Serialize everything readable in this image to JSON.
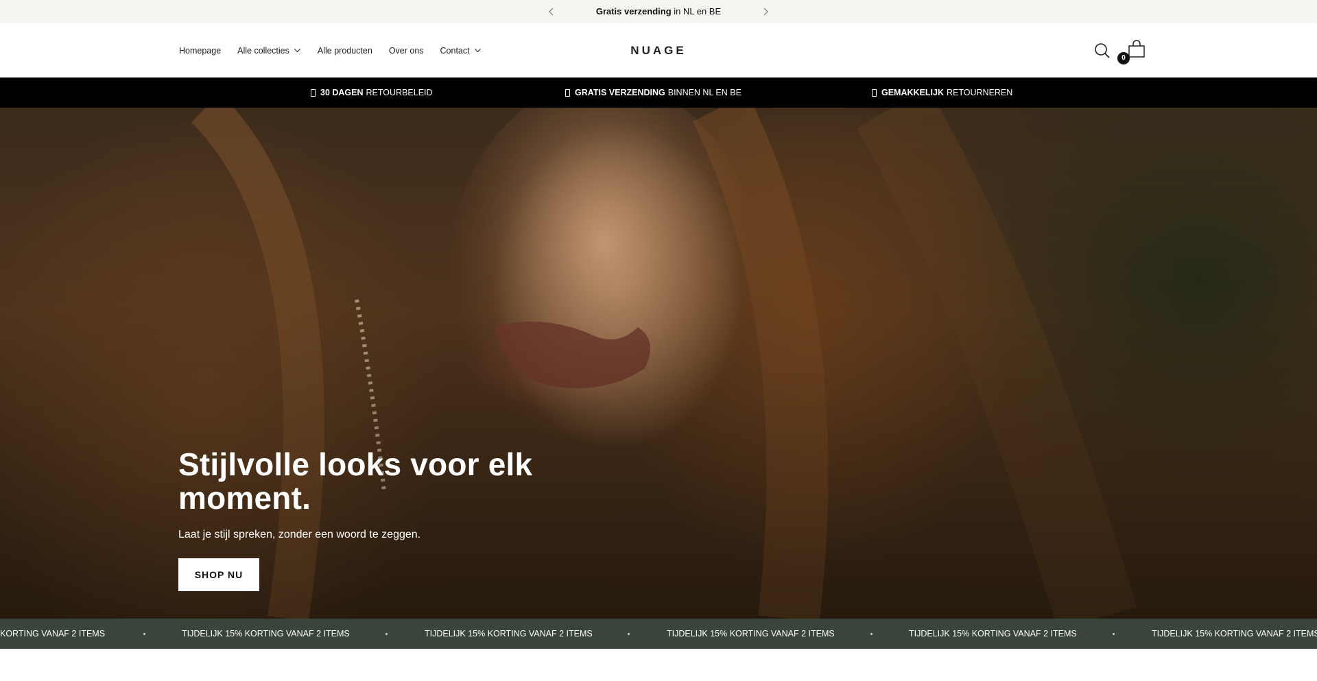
{
  "announcement": {
    "bold": "Gratis verzending",
    "rest": " in NL en BE",
    "prev_icon": "chevron-left-icon",
    "next_icon": "chevron-right-icon"
  },
  "header": {
    "logo": "NUAGE",
    "nav": [
      {
        "label": "Homepage",
        "dropdown": false
      },
      {
        "label": "Alle collecties",
        "dropdown": true
      },
      {
        "label": "Alle producten",
        "dropdown": false
      },
      {
        "label": "Over ons",
        "dropdown": false
      },
      {
        "label": "Contact",
        "dropdown": true
      }
    ],
    "cart_count": "0",
    "search_icon": "search-icon",
    "cart_icon": "shopping-bag-icon"
  },
  "usp": [
    {
      "bold": "30 DAGEN",
      "rest": "RETOURBELEID"
    },
    {
      "bold": "GRATIS VERZENDING",
      "rest": "BINNEN NL EN BE"
    },
    {
      "bold": "GEMAKKELIJK",
      "rest": "RETOURNEREN"
    }
  ],
  "hero": {
    "title": "Stijlvolle looks voor elk moment.",
    "subtitle": "Laat je stijl spreken, zonder een woord te zeggen.",
    "cta": "SHOP NU"
  },
  "marquee": {
    "text": "TIJDELIJK 15% KORTING VANAF 2 ITEMS",
    "partial_text": "KORTING VANAF 2 ITEMS"
  },
  "colors": {
    "announcement_bg": "#f6f5f2",
    "usp_bg": "#000000",
    "marquee_bg": "#39443b",
    "button_bg": "#ffffff"
  }
}
